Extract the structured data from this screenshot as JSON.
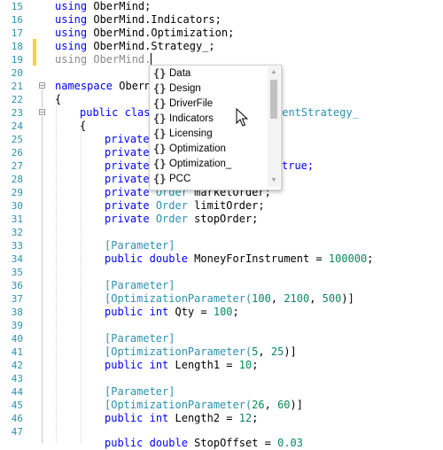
{
  "editor": {
    "gutter": [
      "15",
      "16",
      "17",
      "18",
      "19",
      "20",
      "21",
      "22",
      "23",
      "24",
      "25",
      "26",
      "27",
      "28",
      "29",
      "30",
      "31",
      "32",
      "33",
      "34",
      "35",
      "36",
      "37",
      "38",
      "39",
      "40",
      "41",
      "42",
      "43",
      "44",
      "45",
      "46",
      "47"
    ],
    "lines": {
      "l15": {
        "k": "using",
        "rest": " OberMind;"
      },
      "l16": {
        "k": "using",
        "rest": " OberMind.Indicators;"
      },
      "l17": {
        "k": "using",
        "rest": " OberMind.Optimization;"
      },
      "l18": {
        "k": "using",
        "rest": " OberMind.Strategy_;"
      },
      "l19": {
        "k": "using",
        "rest": " OberMind."
      },
      "l21": {
        "k": "namespace",
        "rest": " Obern"
      },
      "l22": {
        "text": "{"
      },
      "l23": {
        "k": "public",
        "k2": "clas",
        "tail_t": "mentStrategy_"
      },
      "l24": {
        "text": "{"
      },
      "l25": {
        "k": "private"
      },
      "l26": {
        "k": "private"
      },
      "l27": {
        "k": "private",
        "tail": "true;"
      },
      "l28": {
        "k": "private"
      },
      "l29": {
        "k": "private",
        "t": "Order",
        "rest": " marketOrder;"
      },
      "l30": {
        "k": "private",
        "t": "Order",
        "rest": " limitOrder;"
      },
      "l31": {
        "k": "private",
        "t": "Order",
        "rest": " stopOrder;"
      },
      "l33": {
        "t": "[Parameter]"
      },
      "l34": {
        "k": "public",
        "k2": "double",
        "rest": " MoneyForInstrument = ",
        "n": "100000",
        "end": ";"
      },
      "l36": {
        "t": "[Parameter]"
      },
      "l37": {
        "t": "[OptimizationParameter(",
        "n1": "100",
        "n2": "2100",
        "n3": "500",
        "end": ")]"
      },
      "l38": {
        "k": "public",
        "k2": "int",
        "rest": " Qty = ",
        "n": "100",
        "end": ";"
      },
      "l40": {
        "t": "[Parameter]"
      },
      "l41": {
        "t": "[OptimizationParameter(",
        "n1": "5",
        "n2": "25",
        "end": ")]"
      },
      "l42": {
        "k": "public",
        "k2": "int",
        "rest": " Length1 = ",
        "n": "10",
        "end": ";"
      },
      "l44": {
        "t": "[Parameter]"
      },
      "l45": {
        "t": "[OptimizationParameter(",
        "n1": "26",
        "n2": "60",
        "end": ")]"
      },
      "l46": {
        "k": "public",
        "k2": "int",
        "rest": " Length2 = ",
        "n": "12",
        "end": ";"
      },
      "l47": {
        "k": "public",
        "k2": "double",
        "rest": " StopOffset = ",
        "n": "0.03"
      }
    },
    "colors": {
      "keyword": "#0000ff",
      "type": "#2b91af",
      "number": "#09885a",
      "line_number": "#2b91af",
      "change_marker": "#f3d33a"
    }
  },
  "completion": {
    "items": [
      {
        "icon": "namespace-icon",
        "glyph": "{}",
        "label": "Data"
      },
      {
        "icon": "namespace-icon",
        "glyph": "{}",
        "label": "Design"
      },
      {
        "icon": "namespace-icon",
        "glyph": "{}",
        "label": "DriverFile"
      },
      {
        "icon": "namespace-icon",
        "glyph": "{}",
        "label": "Indicators"
      },
      {
        "icon": "namespace-icon",
        "glyph": "{}",
        "label": "Licensing"
      },
      {
        "icon": "namespace-icon",
        "glyph": "{}",
        "label": "Optimization"
      },
      {
        "icon": "namespace-icon",
        "glyph": "{}",
        "label": "Optimization_"
      },
      {
        "icon": "namespace-icon",
        "glyph": "{}",
        "label": "PCC"
      }
    ],
    "scroll_up_glyph": "▲",
    "scroll_down_glyph": "▼"
  }
}
